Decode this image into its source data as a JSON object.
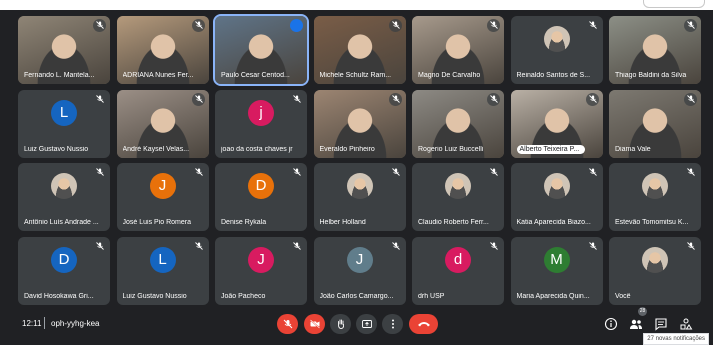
{
  "meeting": {
    "time": "12:11",
    "code": "oph-yyhg-kea"
  },
  "notification": "27 novas notificações",
  "people_badge": "28",
  "participants": [
    {
      "name": "Fernando L. Mantela...",
      "type": "video",
      "bg": "#8f8576"
    },
    {
      "name": "ADRIANA Nunes Fer...",
      "type": "video",
      "bg": "#b59a7c"
    },
    {
      "name": "Paulo Cesar Centod...",
      "type": "video",
      "bg": "#5f7488",
      "active": true
    },
    {
      "name": "Michele Schultz Ram...",
      "type": "video",
      "bg": "#7a5d47"
    },
    {
      "name": "Magno De Carvalho",
      "type": "video",
      "bg": "#a79a8c"
    },
    {
      "name": "Reinaldo Santos de S...",
      "type": "photo",
      "bg": "#3c4043"
    },
    {
      "name": "Thiago Baldini da Silva",
      "type": "video",
      "bg": "#8c8f86"
    },
    {
      "name": "Luiz Gustavo Nussio",
      "type": "letter",
      "letter": "L",
      "color": "#1565c0"
    },
    {
      "name": "André Kaysel Velas...",
      "type": "video",
      "bg": "#9b8f86"
    },
    {
      "name": "joao da costa chaves jr",
      "type": "letter",
      "letter": "j",
      "color": "#d81b60"
    },
    {
      "name": "Everaldo Pinheiro",
      "type": "video",
      "bg": "#9c8572"
    },
    {
      "name": "Rogerio Luiz Buccelli",
      "type": "video",
      "bg": "#8d8a84"
    },
    {
      "name": "Alberto Teixeira P...",
      "type": "video",
      "bg": "#b9b0a5",
      "chip": true
    },
    {
      "name": "Diama Vale",
      "type": "video",
      "bg": "#7d7971"
    },
    {
      "name": "Antônio Luís Andrade ...",
      "type": "photo",
      "bg": "#3c4043"
    },
    {
      "name": "José Luis Pio Romera",
      "type": "letter",
      "letter": "J",
      "color": "#e8710a"
    },
    {
      "name": "Denise Rykala",
      "type": "letter",
      "letter": "D",
      "color": "#e8710a"
    },
    {
      "name": "Helber Holland",
      "type": "photo",
      "bg": "#3c4043"
    },
    {
      "name": "Claudio Roberto Ferr...",
      "type": "photo",
      "bg": "#3c4043"
    },
    {
      "name": "Katia Aparecida Biazo...",
      "type": "photo",
      "bg": "#3c4043"
    },
    {
      "name": "Estevão Tomomitsu K...",
      "type": "photo",
      "bg": "#3c4043"
    },
    {
      "name": "David Hosokawa Gri...",
      "type": "letter",
      "letter": "D",
      "color": "#1565c0"
    },
    {
      "name": "Luiz Gustavo Nussio",
      "type": "letter",
      "letter": "L",
      "color": "#1565c0"
    },
    {
      "name": "João Pacheco",
      "type": "letter",
      "letter": "J",
      "color": "#d81b60"
    },
    {
      "name": "João Carlos Camargo...",
      "type": "letter",
      "letter": "J",
      "color": "#607d8b"
    },
    {
      "name": "drh USP",
      "type": "letter",
      "letter": "d",
      "color": "#d81b60"
    },
    {
      "name": "Maria Aparecida Quin...",
      "type": "letter",
      "letter": "M",
      "color": "#2e7d32"
    },
    {
      "name": "Você",
      "type": "photo",
      "bg": "#3c4043"
    }
  ]
}
